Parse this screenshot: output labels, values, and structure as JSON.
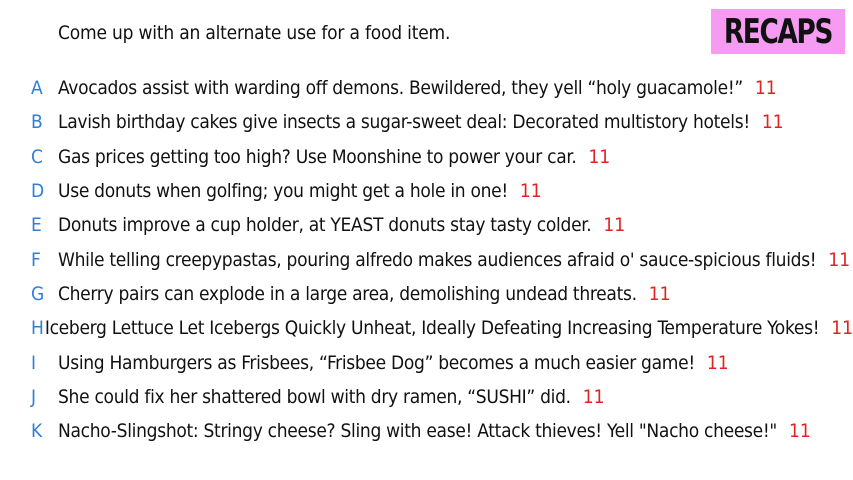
{
  "prompt": "Come up with an alternate use for a food item.",
  "badge": "RECAPS",
  "colors": {
    "badge_background": "#f59bf2",
    "letter": "#2f7fd8",
    "score": "#e02222",
    "text": "#111111"
  },
  "entries": [
    {
      "letter": "A",
      "text": "Avocados assist with warding off demons. Bewildered, they yell “holy guacamole!”",
      "score": "11"
    },
    {
      "letter": "B",
      "text": "Lavish birthday cakes give insects a sugar-sweet deal: Decorated multistory hotels!",
      "score": "11"
    },
    {
      "letter": "C",
      "text": "Gas prices getting too high? Use Moonshine to power your car.",
      "score": "11"
    },
    {
      "letter": "D",
      "text": "Use donuts when golfing; you might get a hole in one!",
      "score": "11"
    },
    {
      "letter": "E",
      "text": "Donuts improve a cup holder, at YEAST donuts stay tasty colder.",
      "score": "11"
    },
    {
      "letter": "F",
      "text": "While telling creepypastas, pouring alfredo makes audiences afraid o' sauce-spicious fluids!",
      "score": "11"
    },
    {
      "letter": "G",
      "text": "Cherry pairs can explode in a large area, demolishing undead threats.",
      "score": "11"
    },
    {
      "letter": "H",
      "text": "Iceberg Lettuce Let Icebergs Quickly Unheat, Ideally Defeating Increasing Temperature Yokes!",
      "score": "11"
    },
    {
      "letter": "I",
      "text": "Using Hamburgers as Frisbees, “Frisbee Dog” becomes a much easier game!",
      "score": "11"
    },
    {
      "letter": "J",
      "text": "She could fix her shattered bowl with dry ramen, “SUSHI” did.",
      "score": "11"
    },
    {
      "letter": "K",
      "text": "Nacho-Slingshot: Stringy cheese? Sling with ease! Attack thieves! Yell \"Nacho cheese!\"",
      "score": "11"
    }
  ]
}
